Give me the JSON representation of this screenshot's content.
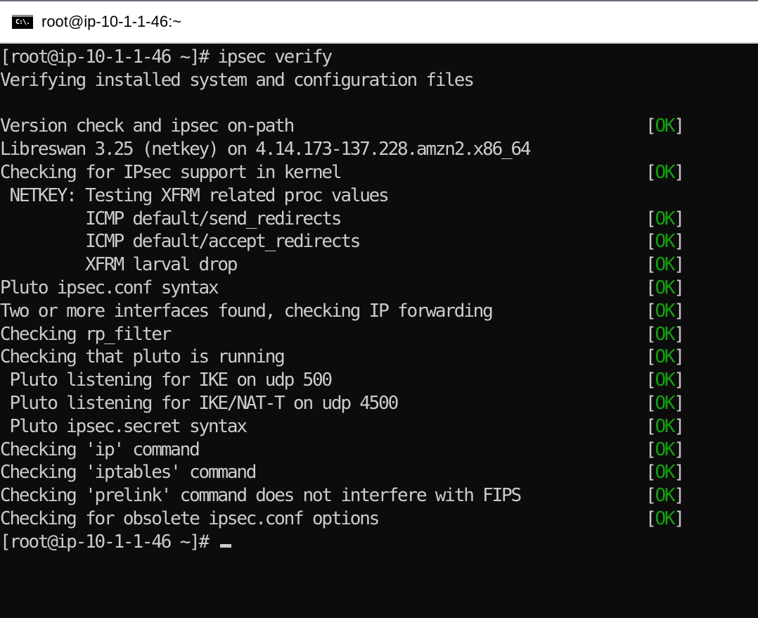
{
  "window": {
    "title": "root@ip-10-1-1-46:~",
    "icon": "console-icon",
    "icon_label": "C:\\."
  },
  "terminal": {
    "colors": {
      "background": "#0c0c0c",
      "text": "#cccccc",
      "ok": "#13a10e"
    },
    "lines": [
      {
        "text": "[root@ip-10-1-1-46 ~]# ipsec verify",
        "status": null
      },
      {
        "text": "Verifying installed system and configuration files",
        "status": null
      },
      {
        "text": "",
        "status": null
      },
      {
        "text": "Version check and ipsec on-path",
        "status": "OK"
      },
      {
        "text": "Libreswan 3.25 (netkey) on 4.14.173-137.228.amzn2.x86_64",
        "status": null
      },
      {
        "text": "Checking for IPsec support in kernel",
        "status": "OK"
      },
      {
        "text": " NETKEY: Testing XFRM related proc values",
        "status": null
      },
      {
        "text": "         ICMP default/send_redirects",
        "status": "OK"
      },
      {
        "text": "         ICMP default/accept_redirects",
        "status": "OK"
      },
      {
        "text": "         XFRM larval drop",
        "status": "OK"
      },
      {
        "text": "Pluto ipsec.conf syntax",
        "status": "OK"
      },
      {
        "text": "Two or more interfaces found, checking IP forwarding",
        "status": "OK"
      },
      {
        "text": "Checking rp_filter",
        "status": "OK"
      },
      {
        "text": "Checking that pluto is running",
        "status": "OK"
      },
      {
        "text": " Pluto listening for IKE on udp 500",
        "status": "OK"
      },
      {
        "text": " Pluto listening for IKE/NAT-T on udp 4500",
        "status": "OK"
      },
      {
        "text": " Pluto ipsec.secret syntax",
        "status": "OK"
      },
      {
        "text": "Checking 'ip' command",
        "status": "OK"
      },
      {
        "text": "Checking 'iptables' command",
        "status": "OK"
      },
      {
        "text": "Checking 'prelink' command does not interfere with FIPS",
        "status": "OK"
      },
      {
        "text": "Checking for obsolete ipsec.conf options",
        "status": "OK"
      }
    ],
    "prompt": "[root@ip-10-1-1-46 ~]# "
  }
}
